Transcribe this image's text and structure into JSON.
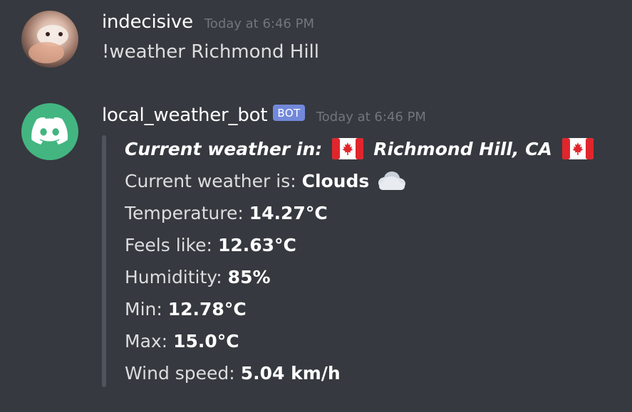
{
  "messages": [
    {
      "username": "indecisive",
      "timestamp": "Today at 6:46 PM",
      "content": "!weather Richmond Hill",
      "avatar": "hamster-photo-avatar"
    },
    {
      "username": "local_weather_bot",
      "bot_tag": "BOT",
      "timestamp": "Today at 6:46 PM",
      "avatar": "discord-logo-icon",
      "embed": {
        "title_prefix": "Current weather in:",
        "title_location": "Richmond Hill, CA",
        "flag_icon": "canada-flag-icon",
        "condition_label": "Current weather is:",
        "condition_value": "Clouds",
        "condition_icon": "cloud-icon",
        "temperature_label": "Temperature:",
        "temperature_value": "14.27°C",
        "feels_like_label": "Feels like:",
        "feels_like_value": "12.63°C",
        "humidity_label": "Humiditity:",
        "humidity_value": "85%",
        "min_label": "Min:",
        "min_value": "12.78°C",
        "max_label": "Max:",
        "max_value": "15.0°C",
        "wind_label": "Wind speed:",
        "wind_value": "5.04 km/h"
      }
    }
  ],
  "colors": {
    "background": "#36393f",
    "username": "#ffffff",
    "text": "#dcddde",
    "timestamp": "#72767d",
    "bot_tag": "#7289da",
    "bot_avatar": "#43b581",
    "embed_bar": "#4f545c",
    "flag_red": "#e0262c"
  }
}
